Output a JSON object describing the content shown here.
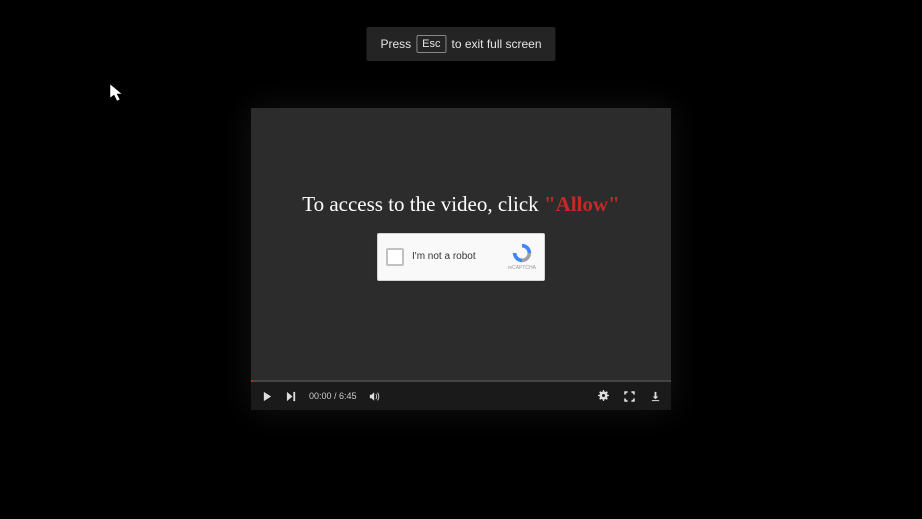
{
  "banner": {
    "press": "Press",
    "key": "Esc",
    "rest": "to exit full screen"
  },
  "overlay": {
    "prefix": "To access to the video, click ",
    "allow": "\"Allow\""
  },
  "recaptcha": {
    "label": "I'm not a robot",
    "brand": "reCAPTCHA"
  },
  "controls": {
    "time": "00:00 / 6:45"
  },
  "colors": {
    "accent": "#c62828",
    "bg": "#000000",
    "player_bg": "#2c2c2c"
  }
}
